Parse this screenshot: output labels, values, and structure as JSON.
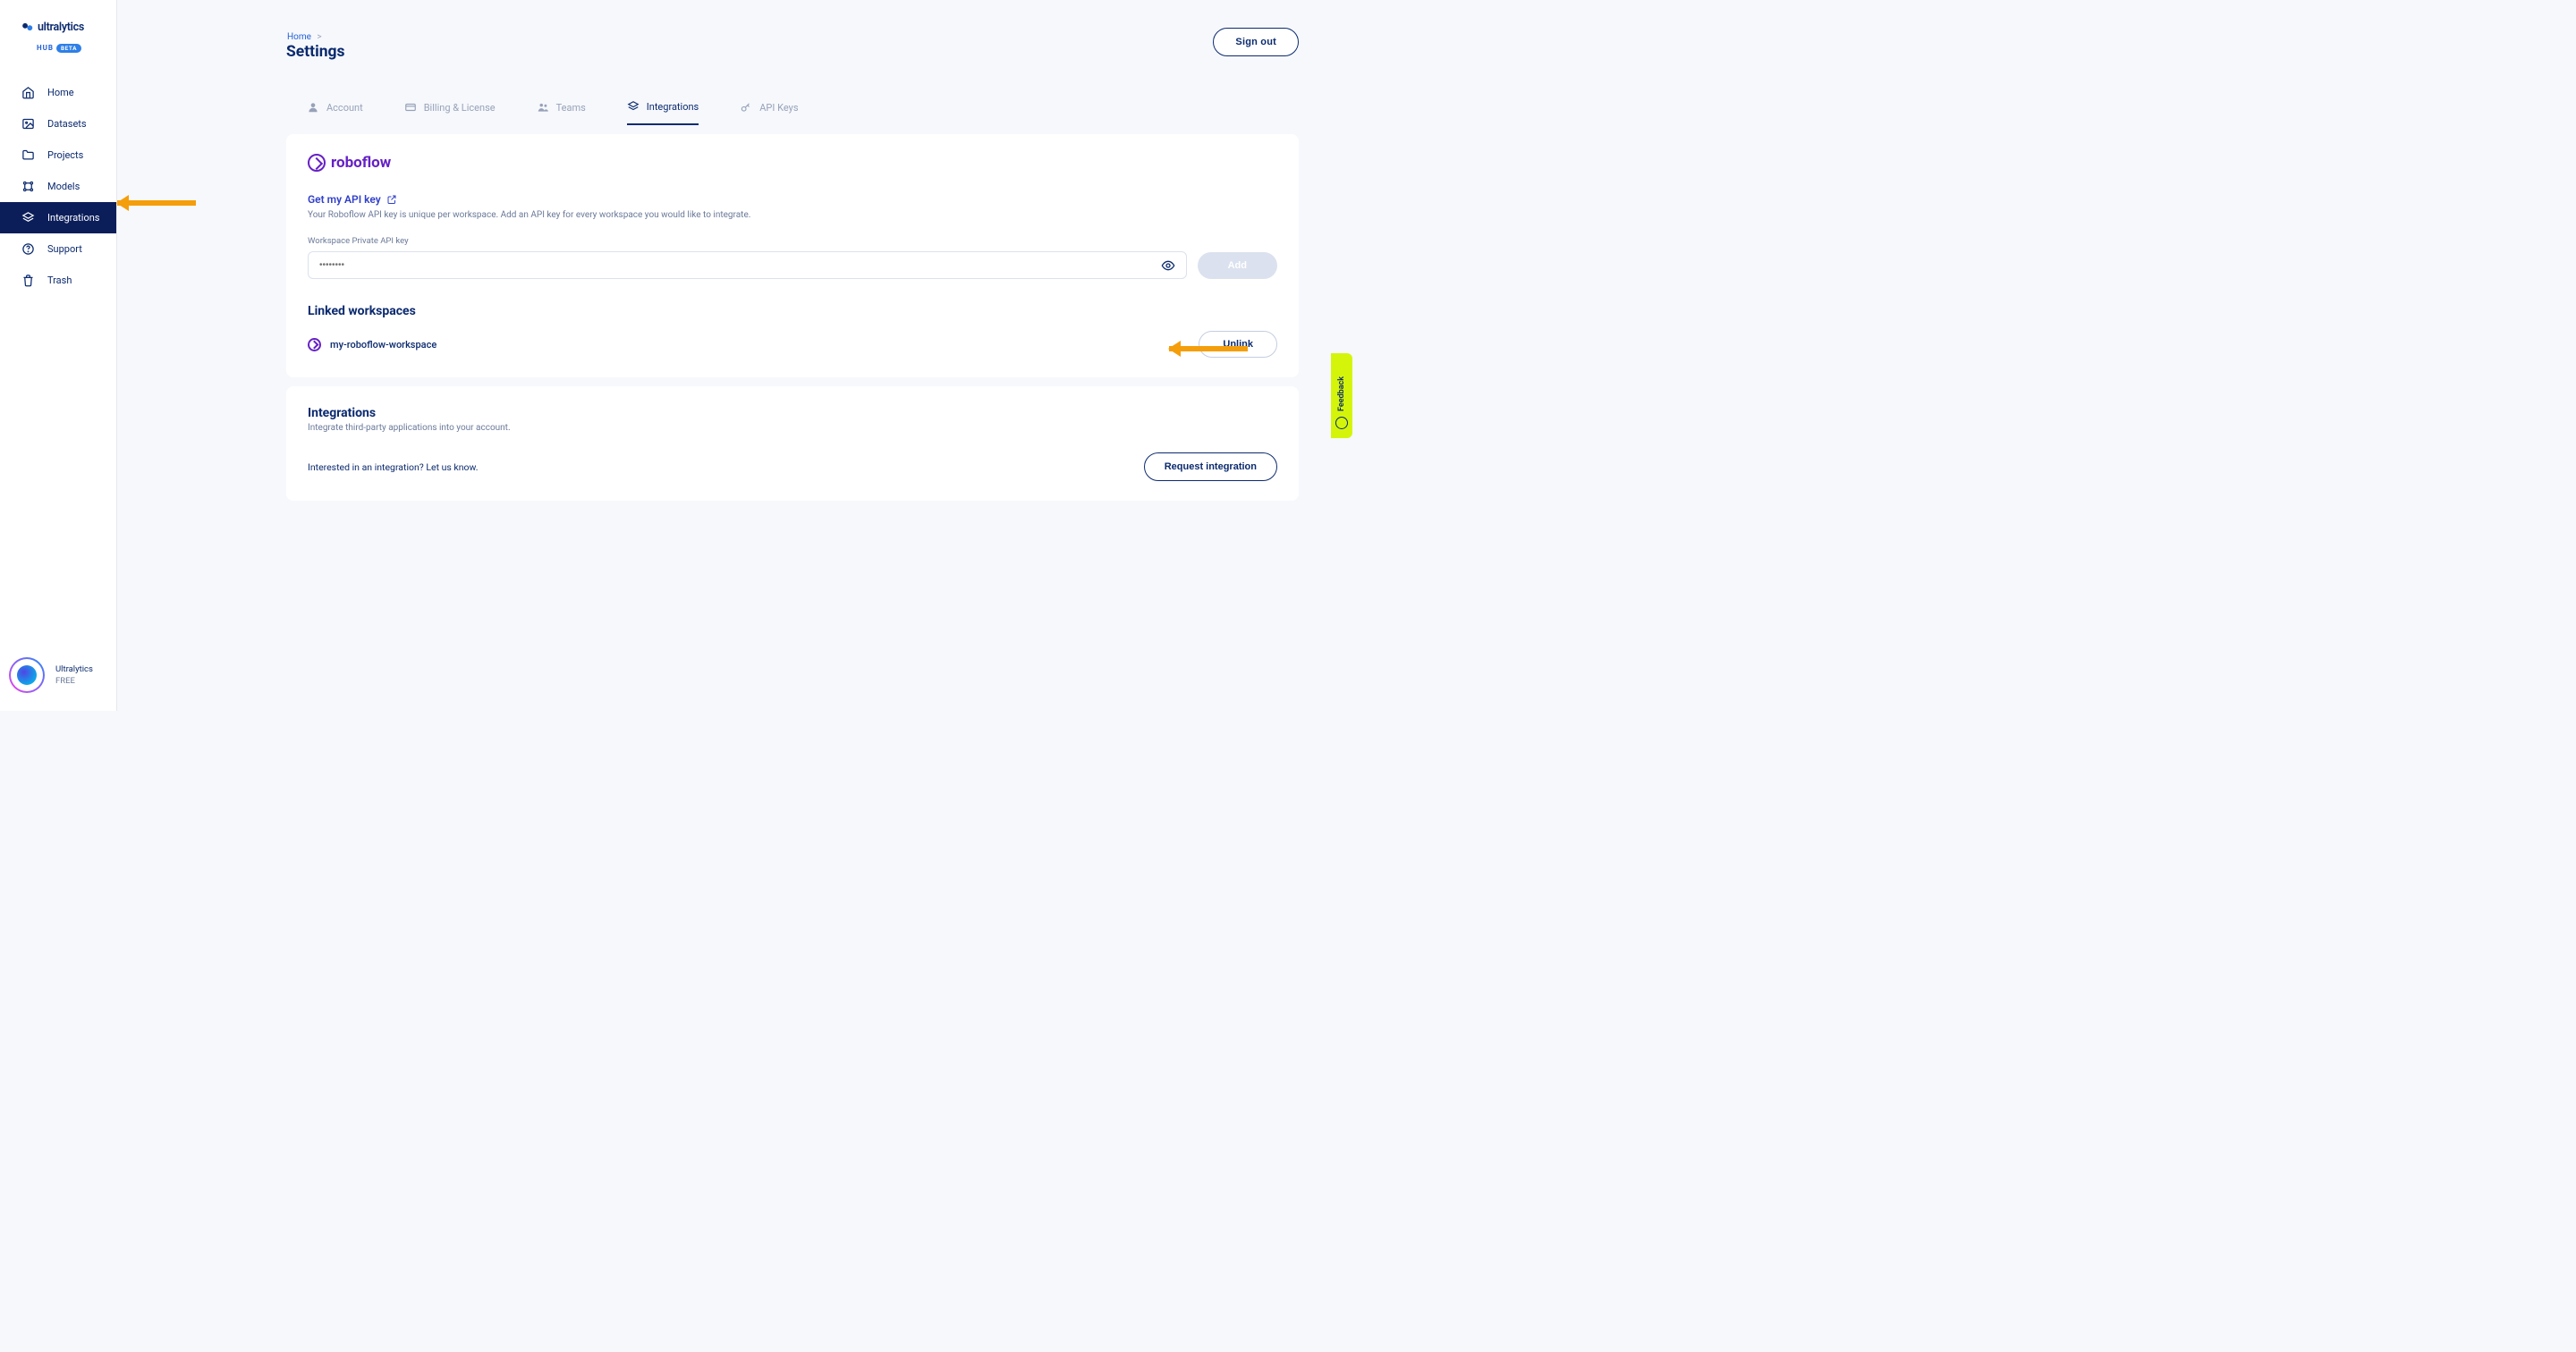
{
  "brand": {
    "name": "ultralytics",
    "hub_label": "HUB",
    "beta_label": "BETA"
  },
  "sidebar": {
    "items": [
      {
        "label": "Home",
        "icon": "home-icon"
      },
      {
        "label": "Datasets",
        "icon": "image-icon"
      },
      {
        "label": "Projects",
        "icon": "folder-icon"
      },
      {
        "label": "Models",
        "icon": "grid-icon"
      },
      {
        "label": "Integrations",
        "icon": "layers-icon",
        "active": true
      },
      {
        "label": "Support",
        "icon": "help-icon"
      },
      {
        "label": "Trash",
        "icon": "trash-icon"
      }
    ]
  },
  "user": {
    "name": "Ultralytics",
    "tier": "FREE"
  },
  "breadcrumb": {
    "root": "Home",
    "sep": ">"
  },
  "page_title": "Settings",
  "signout_label": "Sign out",
  "tabs": [
    {
      "label": "Account",
      "icon": "user-icon"
    },
    {
      "label": "Billing & License",
      "icon": "card-icon"
    },
    {
      "label": "Teams",
      "icon": "team-icon"
    },
    {
      "label": "Integrations",
      "icon": "layers-icon",
      "active": true
    },
    {
      "label": "API Keys",
      "icon": "key-icon"
    }
  ],
  "roboflow": {
    "brand": "roboflow",
    "get_api_link": "Get my API key",
    "desc": "Your Roboflow API key is unique per workspace. Add an API key for every workspace you would like to integrate.",
    "field_label": "Workspace Private API key",
    "input_placeholder": "••••••••",
    "add_label": "Add",
    "linked_title": "Linked workspaces",
    "workspace_name": "my-roboflow-workspace",
    "unlink_label": "Unlink"
  },
  "integrations_card": {
    "title": "Integrations",
    "subtitle": "Integrate third-party applications into your account.",
    "note": "Interested in an integration? Let us know.",
    "request_label": "Request integration"
  },
  "feedback_label": "Feedback"
}
